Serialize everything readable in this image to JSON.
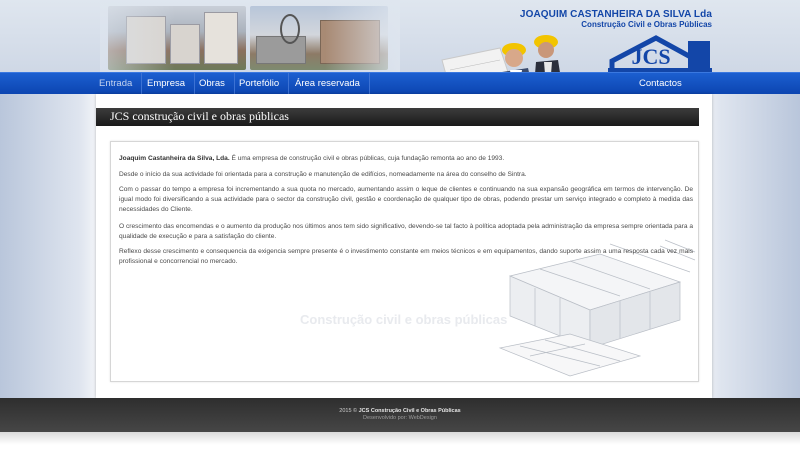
{
  "header": {
    "company_name": "JOAQUIM CASTANHEIRA DA SILVA Lda",
    "company_sub": "Construção Civil e Obras Públicas",
    "logo_text": "JCS"
  },
  "nav": {
    "items": [
      {
        "label": "Entrada",
        "active": true
      },
      {
        "label": "Empresa",
        "active": false
      },
      {
        "label": "Obras",
        "active": false
      },
      {
        "label": "Portefólio",
        "active": false
      },
      {
        "label": "Área reservada",
        "active": false
      }
    ],
    "contact": "Contactos"
  },
  "main": {
    "title": "JCS construção civil e obras públicas",
    "p1_bold": "Joaquim Castanheira da Silva, Lda.",
    "p1_rest": " É uma empresa de construção civil e obras públicas, cuja fundação remonta ao ano de 1993.",
    "p2": "Desde o início da sua actividade foi orientada para a construção e manutenção de edifícios, nomeadamente na área do conselho de Sintra.",
    "p3": "Com o passar do tempo a empresa foi incrementando a sua quota no mercado, aumentando assim o leque de clientes e continuando na sua expansão geográfica em termos de intervenção. De igual modo foi diversificando a sua actividade para o sector da construção civil, gestão e coordenação de qualquer tipo de obras, podendo prestar um serviço integrado e completo à medida das necessidades do Cliente.",
    "p4": "O crescimento das encomendas e o aumento da produção nos últimos anos tem sido significativo, devendo-se tal facto à política adoptada pela administração da empresa sempre orientada para a qualidade de execução e para a satisfação do cliente.",
    "p5": "Reflexo desse crescimento e consequencia da exigencia sempre presente é o investimento constante em meios técnicos e em equipamentos, dando suporte assim a uma resposta cada vez mais profissional e concorrencial no mercado.",
    "watermark": "Construção civil e obras públicas"
  },
  "footer": {
    "year": "2015 ©",
    "company": "JCS Construção Civil e Obras Públicas",
    "developed": "Desenvolvido por: WebDesign"
  },
  "colors": {
    "nav_blue": "#0c45b1",
    "brand_blue": "#1346a8",
    "title_bar": "#1a1a1a"
  }
}
